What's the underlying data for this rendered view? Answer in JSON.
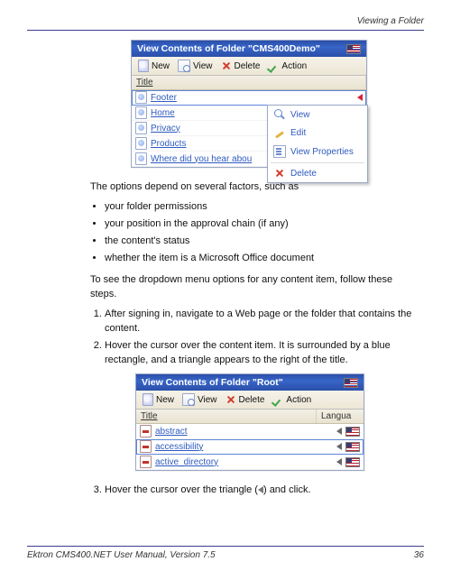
{
  "header_section": "Viewing a Folder",
  "screenshot1": {
    "title": "View Contents of Folder \"CMS400Demo\"",
    "toolbar": {
      "new": "New",
      "view": "View",
      "del": "Delete",
      "action": "Action"
    },
    "col_title": "Title",
    "rows": {
      "r0": "Footer",
      "r1": "Home",
      "r2": "Privacy",
      "r3": "Products",
      "r4": "Where did you hear abou"
    },
    "menu": {
      "m0": "View",
      "m1": "Edit",
      "m2": "View Properties",
      "m3": "Delete"
    }
  },
  "body": {
    "p1": "The options depend on several factors, such as",
    "b1": "your folder permissions",
    "b2": "your position in the approval chain (if any)",
    "b3": "the content's status",
    "b4": "whether the item is a Microsoft Office document",
    "p2": "To see the dropdown menu options for any content item, follow these steps.",
    "s1": "After signing in, navigate to a Web page or the folder that contains the content.",
    "s2": "Hover the cursor over the content item. It is surrounded by a blue rectangle, and a triangle appears to the right of the title.",
    "s3a": "Hover the cursor over the triangle (",
    "s3b": ") and click."
  },
  "screenshot2": {
    "title": "View Contents of Folder \"Root\"",
    "toolbar": {
      "new": "New",
      "view": "View",
      "del": "Delete",
      "action": "Action"
    },
    "col_title": "Title",
    "col_lang": "Langua",
    "rows": {
      "r0": "abstract",
      "r1": "accessibility",
      "r2": "active_directory"
    }
  },
  "footer": {
    "left": "Ektron CMS400.NET User Manual, Version 7.5",
    "right": "36"
  }
}
